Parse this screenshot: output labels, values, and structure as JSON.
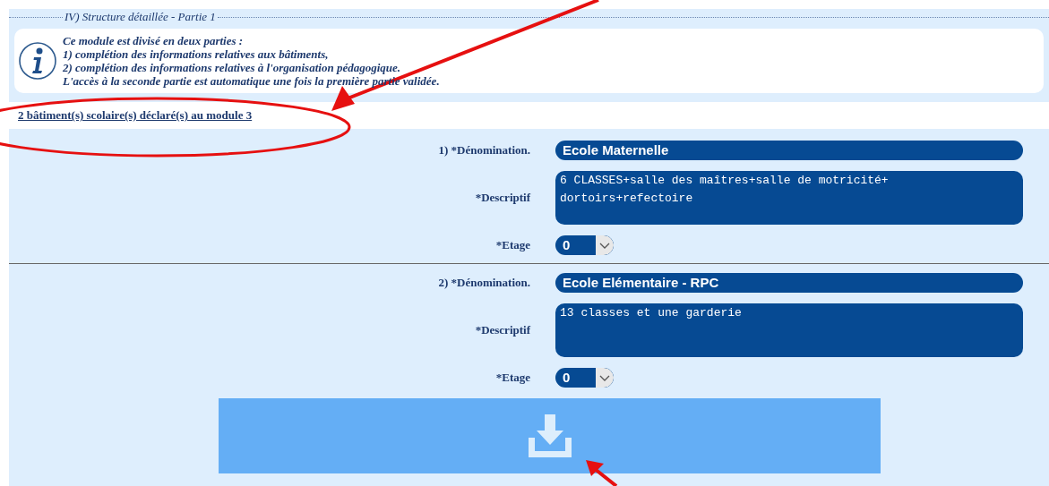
{
  "section": {
    "legend": "IV) Structure détaillée - Partie 1"
  },
  "info": {
    "lines": [
      "Ce module est divisé en deux parties :",
      "1) complétion des informations relatives aux bâtiments,",
      "2) complétion des informations relatives à l'organisation pédagogique.",
      "L'accès à la seconde partie est automatique une fois la première partie validée."
    ]
  },
  "link": "2 bâtiment(s) scolaire(s) déclaré(s) au module 3",
  "buildings": [
    {
      "name_label": "1) *Dénomination.",
      "name": "Ecole Maternelle",
      "desc_label": "*Descriptif",
      "desc": "6 CLASSES+salle des maîtres+salle de motricité+\ndortoirs+refectoire",
      "floor_label": "*Etage",
      "floor": "0"
    },
    {
      "name_label": "2) *Dénomination.",
      "name": "Ecole Elémentaire - RPC",
      "desc_label": "*Descriptif",
      "desc": "13 classes et une garderie",
      "floor_label": "*Etage",
      "floor": "0"
    }
  ]
}
